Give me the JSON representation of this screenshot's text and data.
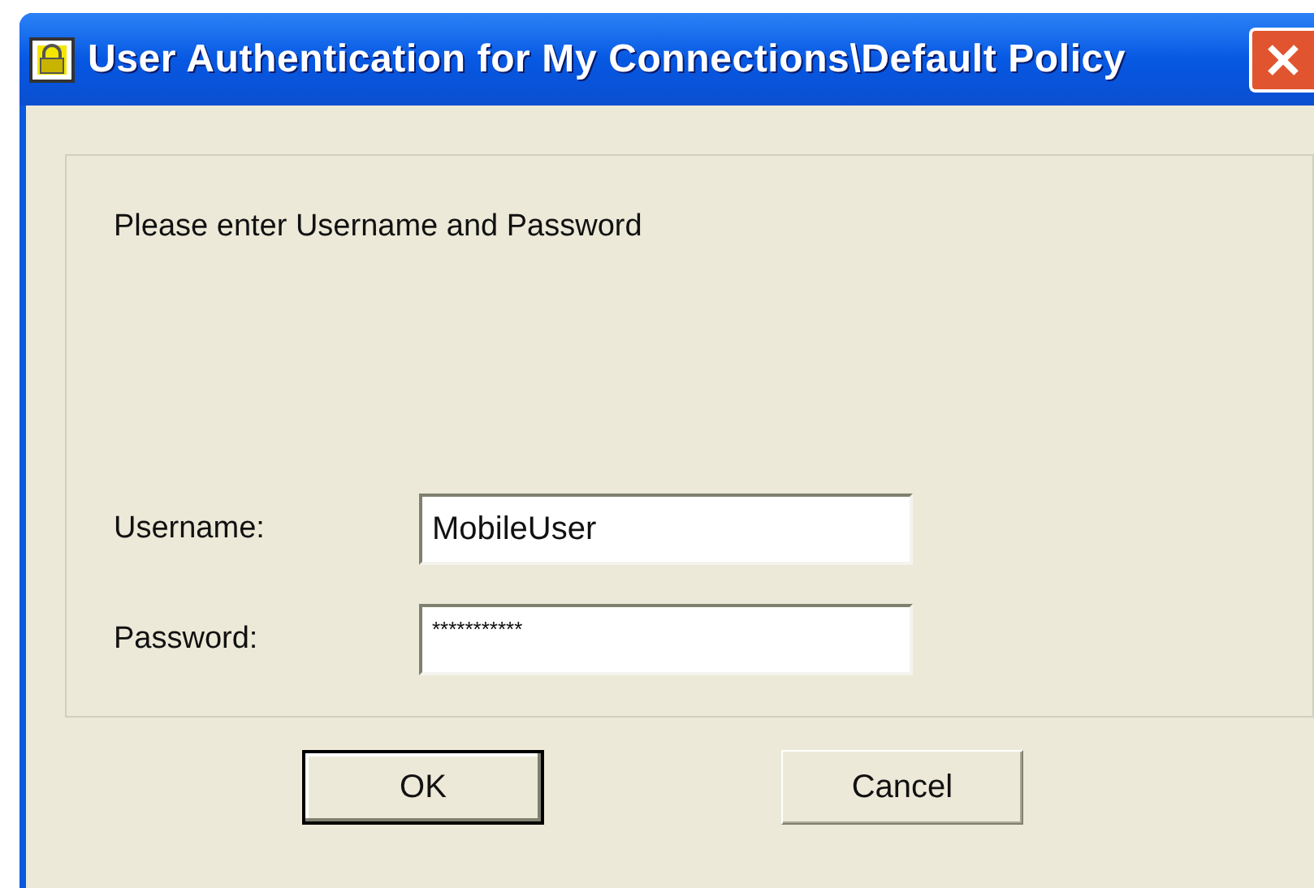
{
  "window": {
    "title": "User Authentication for My Connections\\Default Policy"
  },
  "prompt": "Please enter Username and Password",
  "fields": [
    {
      "label": "Username:",
      "value": "MobileUser"
    },
    {
      "label": "Password:",
      "value": "***********"
    }
  ],
  "buttons": [
    {
      "label": "OK",
      "default": true
    },
    {
      "label": "Cancel",
      "default": false
    }
  ]
}
